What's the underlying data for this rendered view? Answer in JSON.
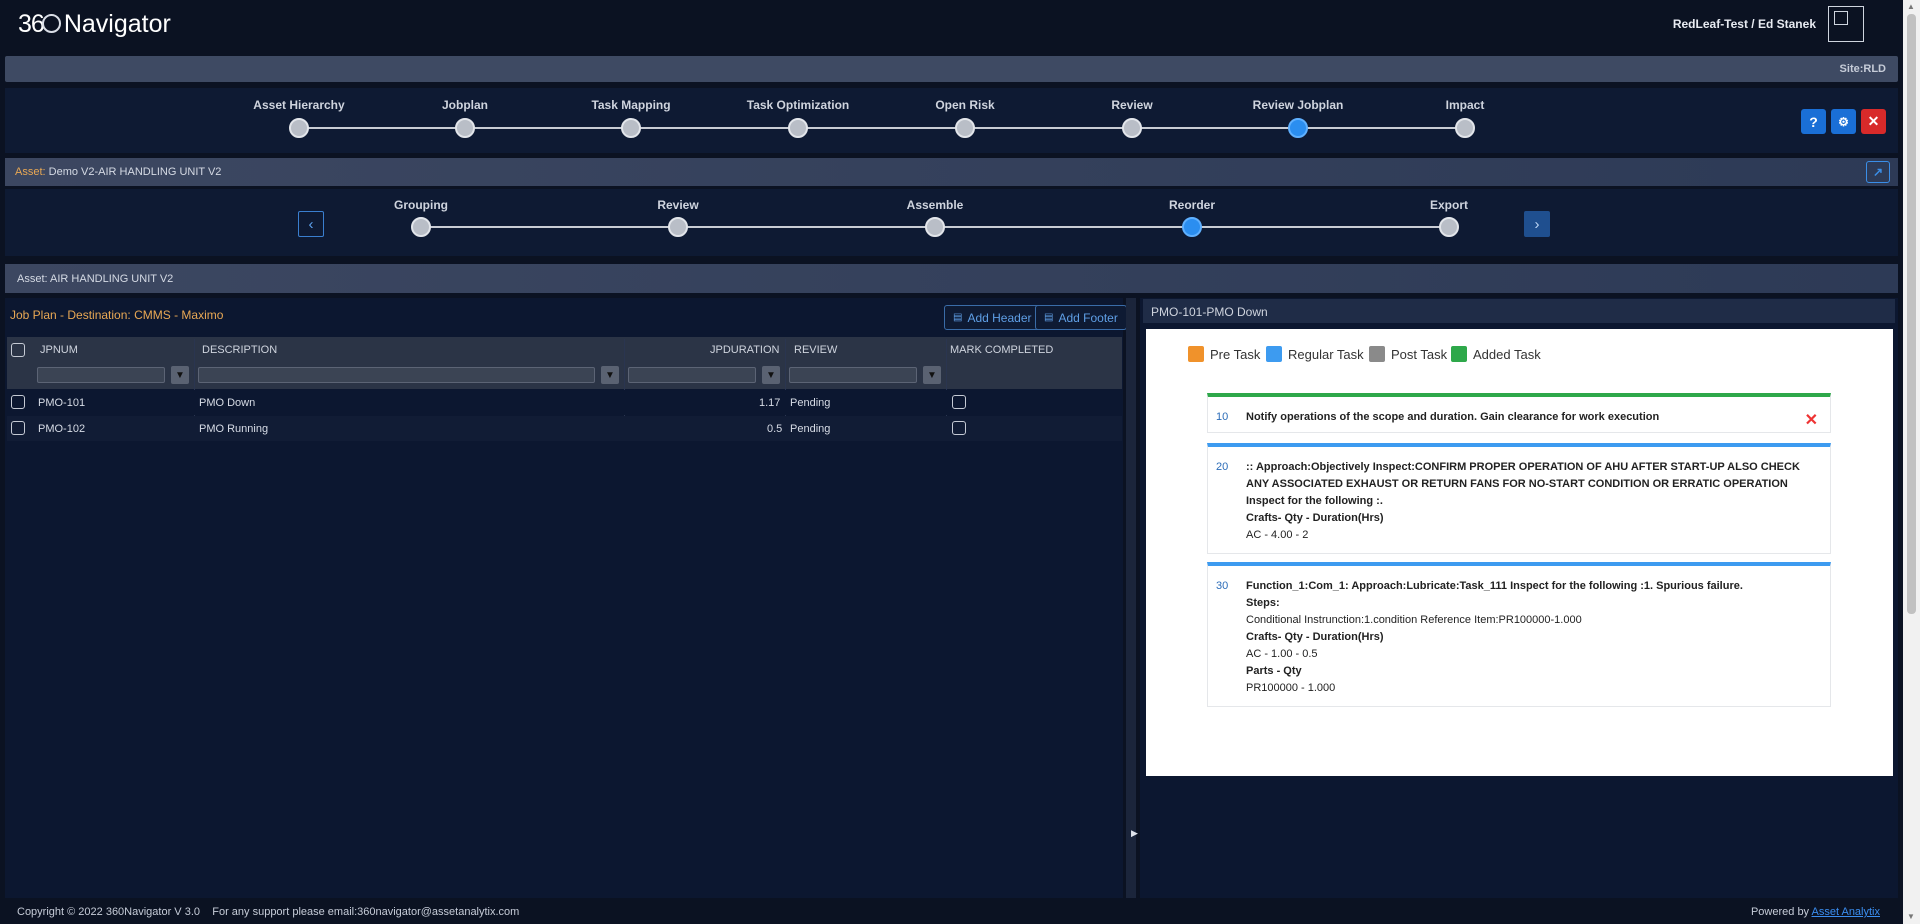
{
  "header": {
    "logo_number": "36",
    "logo_word": "Navigator",
    "user": "RedLeaf-Test / Ed Stanek"
  },
  "site": "Site:RLD",
  "main_steps": [
    {
      "label": "Asset Hierarchy",
      "active": false
    },
    {
      "label": "Jobplan",
      "active": false
    },
    {
      "label": "Task Mapping",
      "active": false
    },
    {
      "label": "Task Optimization",
      "active": false
    },
    {
      "label": "Open Risk",
      "active": false
    },
    {
      "label": "Review",
      "active": false
    },
    {
      "label": "Review Jobplan",
      "active": true
    },
    {
      "label": "Impact",
      "active": false
    }
  ],
  "asset_bar": {
    "prefix": "Asset:",
    "name": "Demo V2-AIR HANDLING UNIT V2"
  },
  "sub_steps": [
    {
      "label": "Grouping",
      "active": false
    },
    {
      "label": "Review",
      "active": false
    },
    {
      "label": "Assemble",
      "active": false
    },
    {
      "label": "Reorder",
      "active": true
    },
    {
      "label": "Export",
      "active": false
    }
  ],
  "asset_bar2": "Asset: AIR HANDLING UNIT V2",
  "jobplan": {
    "title": "Job Plan - Destination: CMMS - Maximo",
    "add_header": "Add Header",
    "add_footer": "Add Footer",
    "columns": [
      "JPNUM",
      "DESCRIPTION",
      "JPDURATION",
      "REVIEW",
      "MARK COMPLETED"
    ],
    "rows": [
      {
        "jpnum": "PMO-101",
        "description": "PMO Down",
        "duration": "1.17",
        "review": "Pending"
      },
      {
        "jpnum": "PMO-102",
        "description": "PMO Running",
        "duration": "0.5",
        "review": "Pending"
      }
    ]
  },
  "preview": {
    "title": "PMO-101-PMO Down",
    "legend": [
      {
        "label": "Pre Task",
        "color": "#f0922b"
      },
      {
        "label": "Regular Task",
        "color": "#3d9bf0"
      },
      {
        "label": "Post Task",
        "color": "#8a8a8a"
      },
      {
        "label": "Added Task",
        "color": "#2ea84a"
      }
    ],
    "tasks": [
      {
        "num": "10",
        "color": "#2ea84a",
        "text": "Notify operations of the scope and duration. Gain clearance for work execution"
      },
      {
        "num": "20",
        "color": "#3d9bf0",
        "text": ":: Approach:Objectively Inspect:CONFIRM PROPER OPERATION OF AHU AFTER START-UP ALSO CHECK ANY ASSOCIATED EXHAUST OR RETURN FANS FOR NO-START CONDITION OR ERRATIC OPERATION Inspect for the following :.",
        "crafts_label": "Crafts- Qty - Duration(Hrs)",
        "crafts": "AC - 4.00 - 2"
      },
      {
        "num": "30",
        "color": "#3d9bf0",
        "text": "Function_1:Com_1: Approach:Lubricate:Task_111 Inspect for the following :1. Spurious failure.",
        "steps_label": "Steps:",
        "steps": "Conditional Instrunction:1.condition Reference Item:PR100000-1.000",
        "crafts_label": "Crafts- Qty - Duration(Hrs)",
        "crafts": "AC - 1.00 - 0.5",
        "parts_label": "Parts - Qty",
        "parts": "PR100000 - 1.000"
      }
    ]
  },
  "footer": {
    "copyright": "Copyright © 2022 360Navigator V 3.0",
    "support": "For any support please email:360navigator@assetanalytix.com",
    "powered_by": "Powered by",
    "powered_link": "Asset Analytix"
  }
}
